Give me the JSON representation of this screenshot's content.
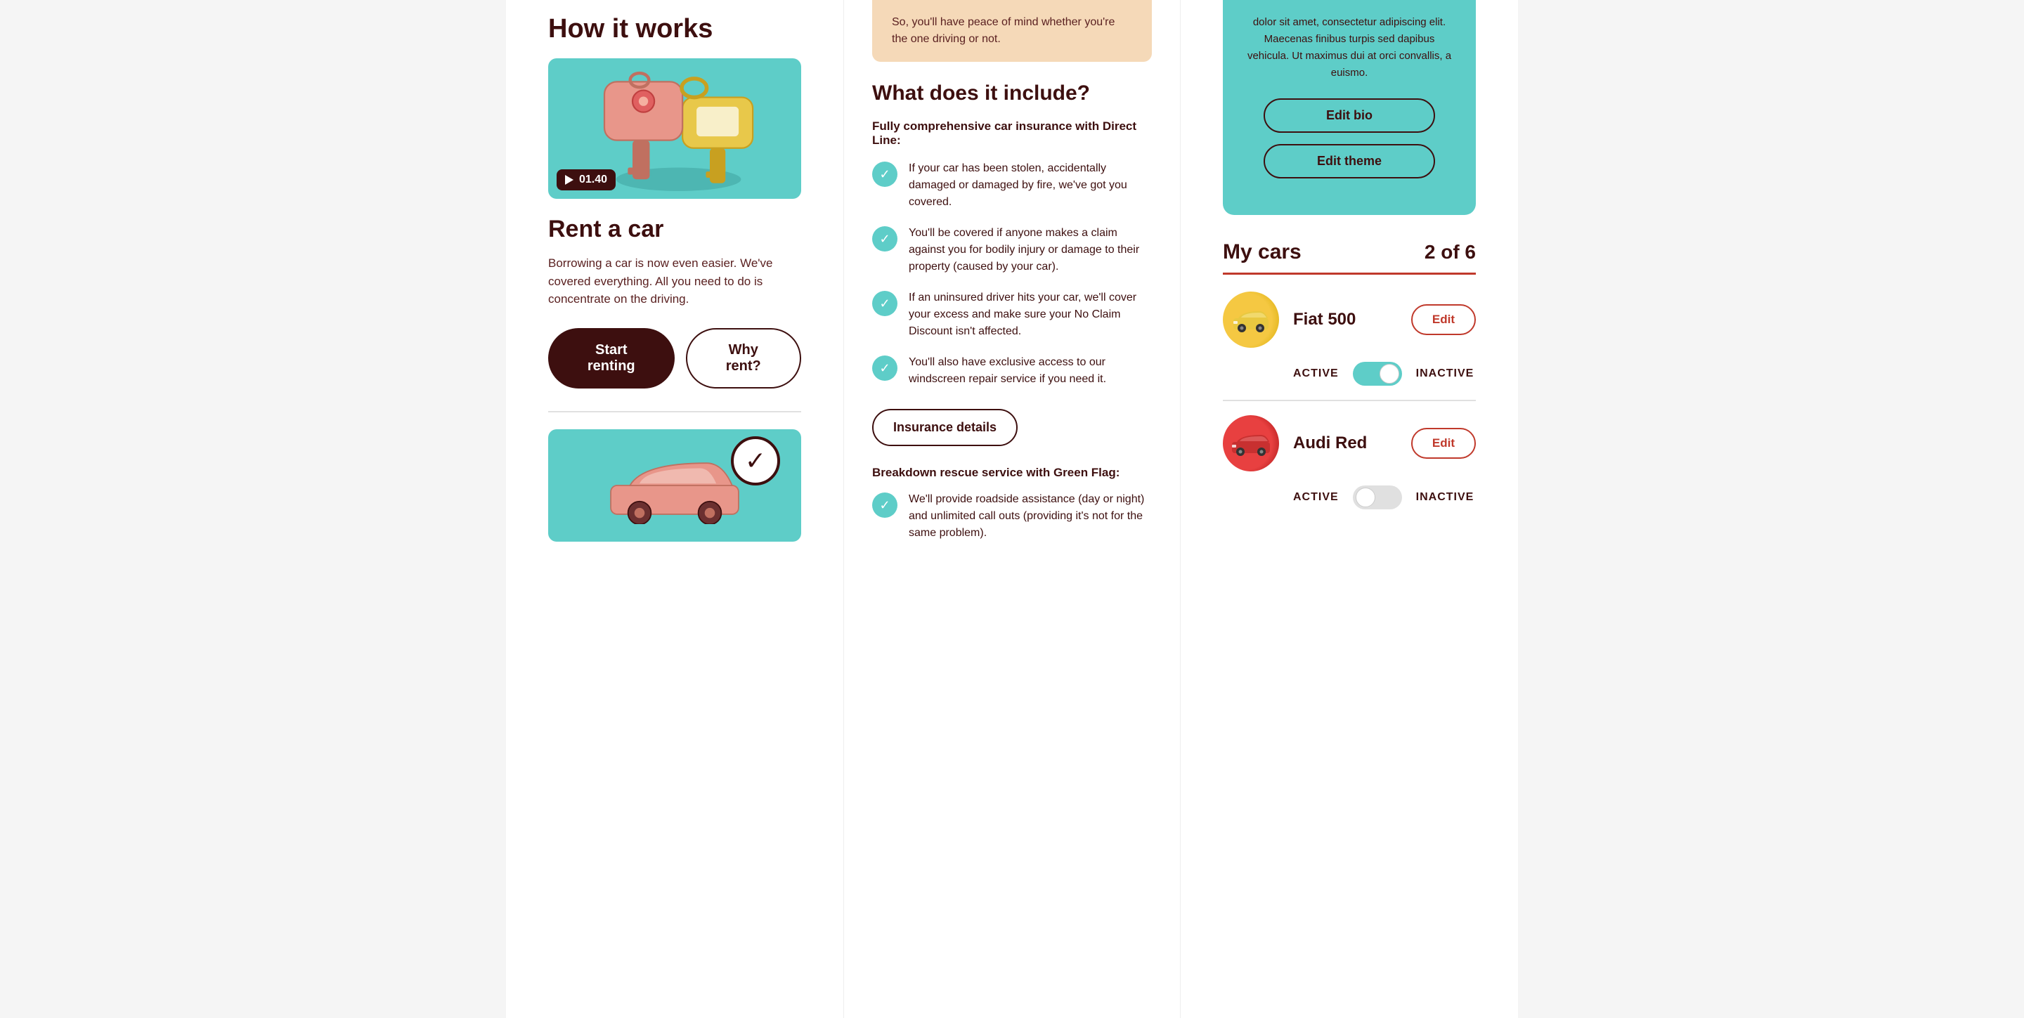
{
  "left": {
    "how_it_works_label": "How it works",
    "video_time": "01.40",
    "rent_a_car_label": "Rent a car",
    "rent_desc": "Borrowing a car is now even easier. We've covered everything. All you need to do is concentrate on the driving.",
    "start_renting_label": "Start renting",
    "why_rent_label": "Why rent?"
  },
  "middle": {
    "banner_text": "So, you'll have peace of mind whether you're the one driving or not.",
    "what_include_label": "What does it include?",
    "direct_line_subtitle": "Fully comprehensive car insurance with Direct Line:",
    "check_items": [
      "If your car has been stolen, accidentally damaged or damaged by fire, we've got you covered.",
      "You'll be covered if anyone makes a claim against you for bodily injury or damage to their property (caused by your car).",
      "If an uninsured driver hits your car, we'll cover your excess and make sure your No Claim Discount isn't affected.",
      "You'll also have exclusive access to our windscreen repair service if you need it."
    ],
    "insurance_details_label": "Insurance details",
    "breakdown_subtitle": "Breakdown rescue service with Green Flag:",
    "breakdown_check": "We'll provide roadside assistance (day or night) and unlimited call outs (providing it's not for the same problem)."
  },
  "right": {
    "bio_text": "dolor sit amet, consectetur adipiscing elit. Maecenas finibus turpis sed dapibus vehicula. Ut maximus dui at orci convallis, a euismo.",
    "edit_bio_label": "Edit bio",
    "edit_theme_label": "Edit theme",
    "my_cars_label": "My cars",
    "cars_count": "2 of 6",
    "cars": [
      {
        "name": "Fiat 500",
        "color": "yellow",
        "status": "active",
        "edit_label": "Edit"
      },
      {
        "name": "Audi  Red",
        "color": "red",
        "status": "inactive",
        "edit_label": "Edit"
      }
    ],
    "active_label": "ACTIVE",
    "inactive_label": "INACTIVE"
  }
}
